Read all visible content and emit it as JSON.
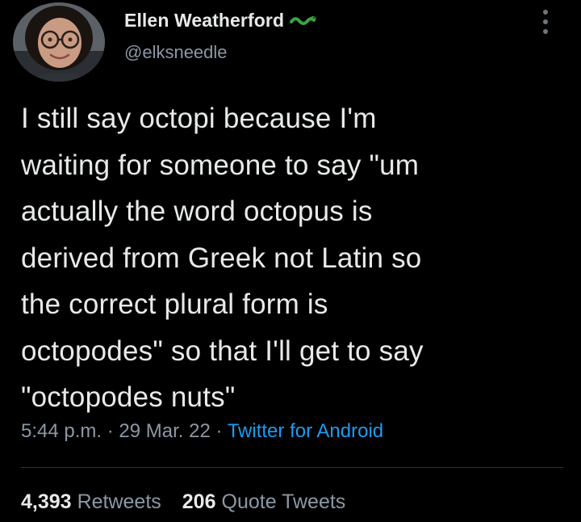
{
  "author": {
    "display_name": "Ellen Weatherford",
    "handle": "@elksneedle",
    "name_icon": "snake-emoji-icon",
    "avatar_icon": "avatar-photo"
  },
  "tweet": {
    "text": "I still say octopi because I'm\nwaiting for someone to say \"um\nactually the word octopus is\nderived from Greek not Latin so\nthe correct plural form is\noctopodes\" so that I'll get to say\n\"octopodes nuts\"",
    "time": "5:44 p.m.",
    "separator": "·",
    "date": "29 Mar. 22",
    "source": "Twitter for Android"
  },
  "stats": {
    "retweets_count": "4,393",
    "retweets_label": "Retweets",
    "quotes_count": "206",
    "quotes_label": "Quote Tweets"
  },
  "icons": {
    "more": "more-options-icon"
  },
  "colors": {
    "background": "#000000",
    "text": "#e7e9ea",
    "secondary": "#8b98a5",
    "link": "#1d9bf0"
  }
}
